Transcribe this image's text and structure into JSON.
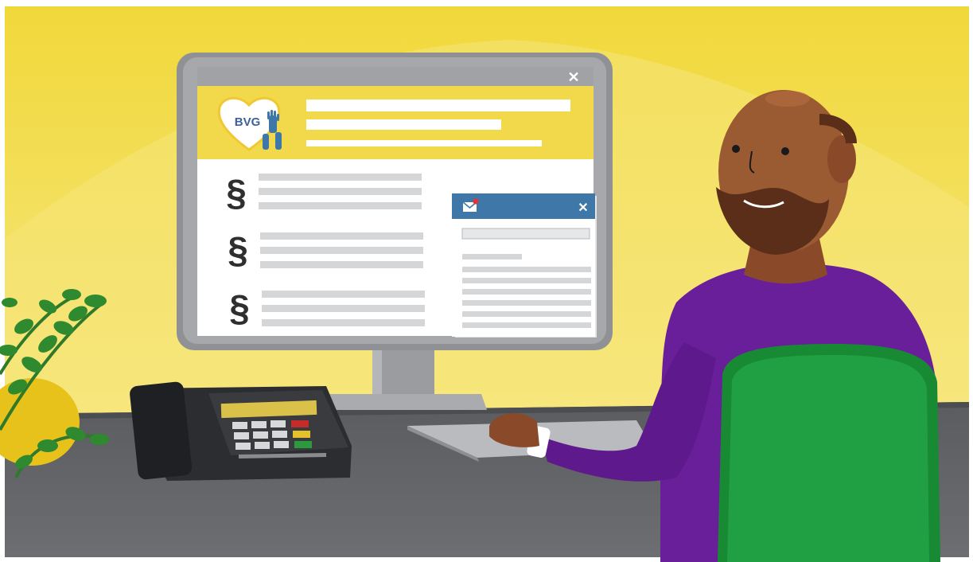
{
  "logo": {
    "text": "BVG"
  },
  "content": {
    "section_symbol": "§"
  },
  "window": {
    "close_glyph": "✕"
  },
  "mail": {
    "close_glyph": "✕"
  },
  "colors": {
    "background_yellow": "#f2dc3a",
    "desk": "#5d5f63",
    "accent_yellow": "#f2d84b",
    "mail_header_blue": "#3f78a8",
    "shirt_purple": "#6a1f9a",
    "chair_green": "#1f9a3c",
    "skin": "#9a5a32"
  }
}
